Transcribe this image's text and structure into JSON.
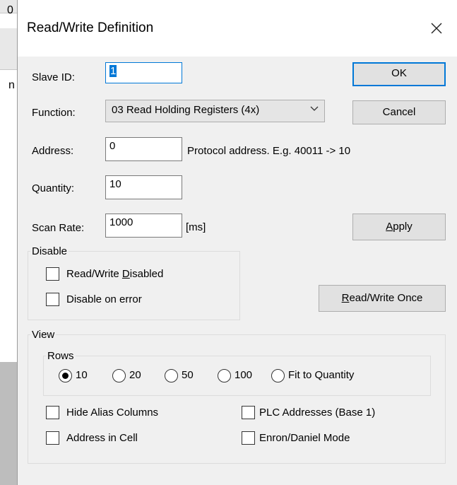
{
  "background": {
    "fragments": [
      "0",
      "n"
    ]
  },
  "dialog": {
    "title": "Read/Write Definition",
    "close_icon": "close-icon"
  },
  "fields": {
    "slave_id": {
      "label": "Slave ID:",
      "value": "1"
    },
    "function": {
      "label": "Function:",
      "value": "03 Read Holding Registers (4x)"
    },
    "address": {
      "label": "Address:",
      "value": "0",
      "hint": "Protocol address. E.g. 40011 -> 10"
    },
    "quantity": {
      "label": "Quantity:",
      "value": "10"
    },
    "scan_rate": {
      "label": "Scan Rate:",
      "value": "1000",
      "unit": "[ms]"
    }
  },
  "buttons": {
    "ok": "OK",
    "cancel": "Cancel",
    "apply_accel": "A",
    "apply_rest": "pply",
    "rw_once_accel": "R",
    "rw_once_rest": "ead/Write Once"
  },
  "disable_group": {
    "title": "Disable",
    "rw_disabled_pre": "Read/Write ",
    "rw_disabled_accel": "D",
    "rw_disabled_post": "isabled",
    "rw_disabled_checked": false,
    "disable_on_error": "Disable on error",
    "disable_on_error_checked": false
  },
  "view_group": {
    "title": "View",
    "rows": {
      "title": "Rows",
      "options": [
        "10",
        "20",
        "50",
        "100",
        "Fit to Quantity"
      ],
      "selected": "10"
    },
    "hide_alias_columns": "Hide Alias Columns",
    "address_in_cell": "Address in Cell",
    "plc_addresses": "PLC Addresses (Base 1)",
    "enron_daniel_mode": "Enron/Daniel Mode"
  },
  "colors": {
    "accent": "#0078d7",
    "dialog_bg": "#f0f0f0",
    "button_bg": "#e1e1e1"
  }
}
